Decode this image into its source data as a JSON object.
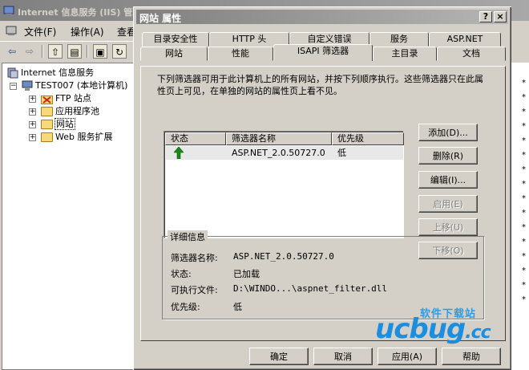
{
  "background_window": {
    "title": "Internet 信息服务 (IIS) 管理器",
    "menus": [
      "文件(F)",
      "操作(A)",
      "查看"
    ],
    "tree": {
      "root": "Internet 信息服务",
      "computer": "TEST007 (本地计算机)",
      "children": [
        "FTP 站点",
        "应用程序池",
        "网站",
        "Web 服务扩展"
      ]
    }
  },
  "dialog": {
    "title": "网站 属性",
    "title_buttons": {
      "help": "?",
      "close": "×"
    },
    "tabs_back": [
      "目录安全性",
      "HTTP 头",
      "自定义错误",
      "服务",
      "ASP.NET"
    ],
    "tabs_front": [
      "网站",
      "性能",
      "ISAPI 筛选器",
      "主目录",
      "文档"
    ],
    "active_tab": "ISAPI 筛选器",
    "description": "下列筛选器可用于此计算机上的所有网站，并按下列顺序执行。这些筛选器只在此属性页上可见，在单独的网站的属性页上看不见。",
    "filter_list": {
      "columns": [
        "状态",
        "筛选器名称",
        "优先级"
      ],
      "rows": [
        {
          "status_icon": "green-up-arrow-icon",
          "name": "ASP.NET_2.0.50727.0",
          "priority": "低"
        }
      ]
    },
    "side_buttons": [
      {
        "label": "添加(D)...",
        "enabled": true
      },
      {
        "label": "删除(R)",
        "enabled": true
      },
      {
        "label": "编辑(I)...",
        "enabled": true
      },
      {
        "label": "启用(E)",
        "enabled": false
      },
      {
        "label": "上移(U)",
        "enabled": false
      },
      {
        "label": "下移(O)",
        "enabled": false
      }
    ],
    "details": {
      "title": "详细信息",
      "name_label": "筛选器名称:",
      "name_value": "ASP.NET_2.0.50727.0",
      "status_label": "状态:",
      "status_value": "已加载",
      "exe_label": "可执行文件:",
      "exe_value": "D:\\WINDO...\\aspnet_filter.dll",
      "priority_label": "优先级:",
      "priority_value": "低"
    },
    "footer_buttons": [
      "确定",
      "取消",
      "应用(A)",
      "帮助"
    ]
  },
  "watermark": {
    "big": "ucbug",
    "suffix": ".cc",
    "small": "软件下载站"
  }
}
